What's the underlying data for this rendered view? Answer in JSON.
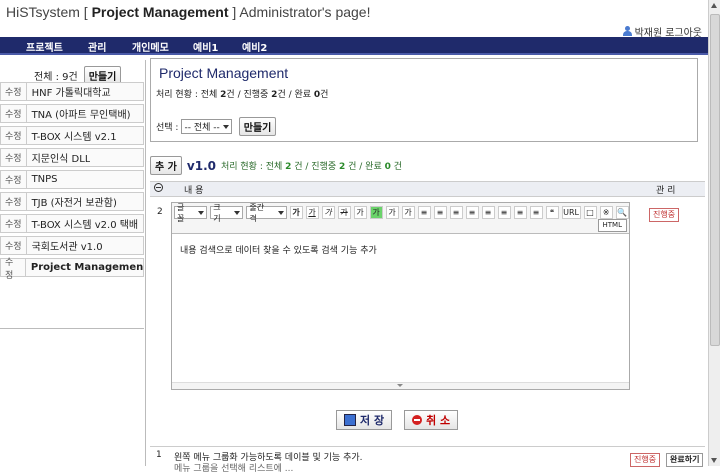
{
  "header": {
    "title_prefix": "HiSTsystem [ ",
    "title_main": "Project Management",
    "title_suffix": " ] Administrator's page!",
    "user_name": "박재원",
    "logout": "로그아웃"
  },
  "nav": [
    "프로젝트",
    "관리",
    "개인메모",
    "예비1",
    "예비2"
  ],
  "sidebar": {
    "count_label": "전체 : 9건",
    "create_button": "만들기",
    "edit_label": "수정",
    "items": [
      "HNF 가톨릭대학교",
      "TNA (아파트 무인택배)",
      "T-BOX 시스템 v2.1",
      "지문인식 DLL",
      "TNPS",
      "TJB (자전거 보관함)",
      "T-BOX 시스템 v2.0 택배",
      "국회도서관 v1.0",
      "Project Management"
    ]
  },
  "project": {
    "title": "Project Management",
    "status_prefix": "처리 현황 : 전체 ",
    "total": "2",
    "status_mid1": "건 / 진행중 ",
    "in_progress": "2",
    "status_mid2": "건 / 완료 ",
    "done": "0",
    "status_suffix": "건",
    "select_label": "선택 :",
    "select_value": "-- 전체 --",
    "create_button": "만들기"
  },
  "version_bar": {
    "add_button": "추 가",
    "version": "v1.0",
    "status_prefix": "처리 현황 : 전체 ",
    "total": "2",
    "status_mid1": " 건 / 진행중 ",
    "in_progress": "2",
    "status_mid2": " 건 / 완료 ",
    "done": "0",
    "status_suffix": " 건"
  },
  "table": {
    "col_content": "내 용",
    "col_manage": "관 리"
  },
  "editor": {
    "row_number": "2",
    "font_select": "글꼴",
    "size_select": "크기",
    "spacing_select": "줄간격",
    "format_buttons": [
      "가",
      "가",
      "가",
      "가",
      "가",
      "가",
      "가",
      "가"
    ],
    "align_buttons": [
      "≡",
      "≡",
      "≡",
      "≡",
      "≡",
      "≡",
      "≡",
      "≡"
    ],
    "misc_buttons": [
      "❝",
      "URL",
      "□",
      "※",
      "🔍"
    ],
    "html_button": "HTML",
    "content": "내용 검색으로 데이터 찾을 수 있도록 검색 기능 추가",
    "status_button": "진행중"
  },
  "actions": {
    "save": "저 장",
    "cancel": "취 소"
  },
  "rows": [
    {
      "number": "1",
      "text": "왼쪽 메뉴 그룹화 가능하도록 데이블 및 기능 추가.",
      "text2": "메뉴 그룹을 선택해 리스트에 ...",
      "status": "진행중",
      "done_button": "완료하기"
    }
  ],
  "colors": {
    "nav_bg": "#1f2a6b",
    "title": "#1f2a6b",
    "highlight": "#6ad36a",
    "status_red": "#c03030"
  }
}
